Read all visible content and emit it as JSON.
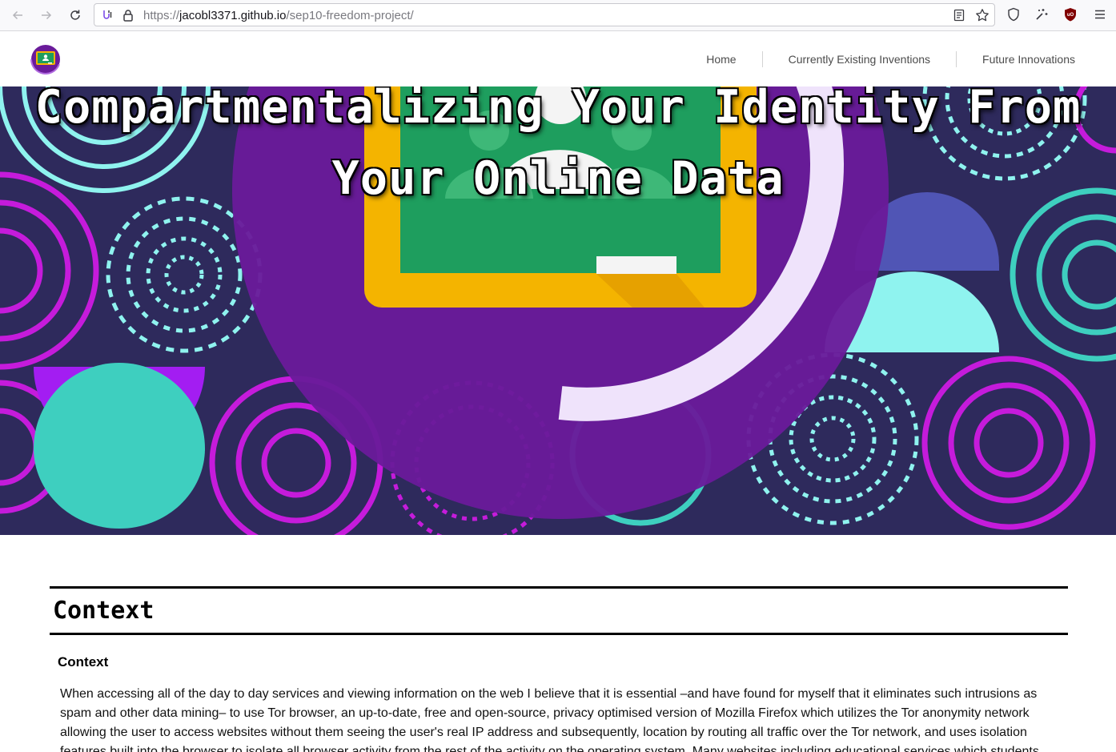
{
  "browser": {
    "url_scheme": "https://",
    "url_host": "jacobl3371.github.io",
    "url_path": "/sep10-freedom-project/",
    "icons": [
      "back-icon",
      "forward-icon",
      "reload-icon",
      "permissions-icon",
      "lock-icon",
      "reader-view-icon",
      "bookmark-star-icon",
      "shield-icon",
      "extension-icon",
      "ublock-icon",
      "menu-icon"
    ]
  },
  "header": {
    "logo": "google-classroom-logo",
    "nav": [
      {
        "label": "Home"
      },
      {
        "label": "Currently Existing Inventions"
      },
      {
        "label": "Future Innovations"
      }
    ]
  },
  "hero": {
    "title_line1": "Compartmentalizing Your Identity From",
    "title_line2": "Your Online Data"
  },
  "content": {
    "section_title": "Context",
    "sub_title": "Context",
    "paragraph": "When accessing all of the day to day services and viewing information on the web I believe that it is essential –and have found for myself that it eliminates such intrusions as spam and other data mining– to use Tor browser, an up-to-date, free and open-source, privacy optimised version of Mozilla Firefox which utilizes the Tor anonymity network allowing the user to access websites without them seeing the user's real IP address and subsequently, location by routing all traffic over the Tor network, and uses isolation features built into the browser to isolate all browser activity from the rest of the activity on the operating system. Many websites including educational services which students"
  },
  "colors": {
    "hero_bg": "#2e2a5c",
    "magenta": "#c51bdb",
    "cyan": "#8ff3ef",
    "teal": "#3ecfbf",
    "purple": "#6a1b9a",
    "board_green": "#1e9e5e",
    "board_frame": "#f4b400"
  }
}
